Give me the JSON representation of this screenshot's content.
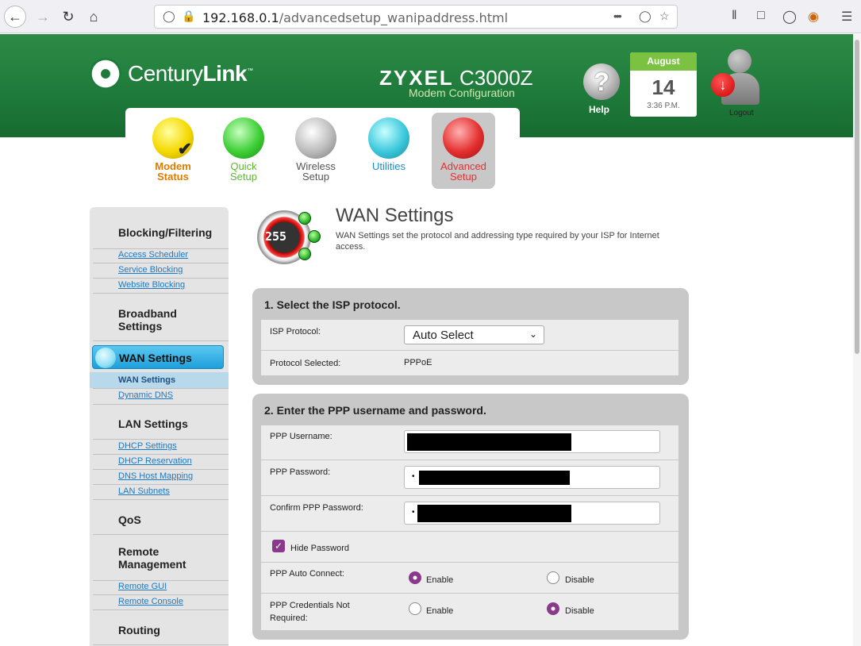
{
  "browser": {
    "url_host": "192.168.0.1",
    "url_path": "/advancedsetup_wanipaddress.html",
    "menu_dots": "•••"
  },
  "header": {
    "logo_prefix": "Century",
    "logo_bold": "Link",
    "logo_tm": "™",
    "brand": "ZYXEL",
    "model": "C3000Z",
    "subtitle": "Modem Configuration",
    "help_label": "Help",
    "date_month": "August",
    "date_day": "14",
    "date_time": "3:36 P.M.",
    "logout_label": "Logout"
  },
  "tabs": [
    {
      "line1": "Modem",
      "line2": "Status"
    },
    {
      "line1": "Quick",
      "line2": "Setup"
    },
    {
      "line1": "Wireless",
      "line2": "Setup"
    },
    {
      "line1": "Utilities",
      "line2": ""
    },
    {
      "line1": "Advanced",
      "line2": "Setup"
    }
  ],
  "sidebar": {
    "blocking_head": "Blocking/Filtering",
    "blocking_links": [
      "Access Scheduler",
      "Service Blocking",
      "Website Blocking"
    ],
    "broadband_head_1": "Broadband",
    "broadband_head_2": "Settings",
    "wan_active": "WAN Settings",
    "wan_sub_active": "WAN Settings",
    "wan_links": [
      "Dynamic DNS"
    ],
    "lan_head": "LAN Settings",
    "lan_links": [
      "DHCP Settings",
      "DHCP Reservation",
      "DNS Host Mapping",
      "LAN Subnets"
    ],
    "qos_head": "QoS",
    "remote_head_1": "Remote",
    "remote_head_2": "Management",
    "remote_links": [
      "Remote GUI",
      "Remote Console"
    ],
    "routing_head": "Routing"
  },
  "main": {
    "icon_number": "255",
    "title": "WAN Settings",
    "description": "WAN Settings set the protocol and addressing type required by your ISP for Internet access.",
    "section1": {
      "title": "1. Select the ISP protocol.",
      "protocol_label": "ISP Protocol:",
      "protocol_value": "Auto Select",
      "selected_label": "Protocol Selected:",
      "selected_value": "PPPoE"
    },
    "section2": {
      "title": "2. Enter the PPP username and password.",
      "username_label": "PPP Username:",
      "password_label": "PPP Password:",
      "confirm_label": "Confirm PPP Password:",
      "password_bullet": "•",
      "hide_password_label": "Hide Password",
      "hide_password_checked": true,
      "auto_connect_label": "PPP Auto Connect:",
      "auto_connect_value": "Enable",
      "credentials_label_1": "PPP Credentials Not",
      "credentials_label_2": "Required:",
      "credentials_value": "Disable",
      "enable_label": "Enable",
      "disable_label": "Disable"
    }
  },
  "colors": {
    "header_green": "#1e7a3a",
    "accent_purple": "#8b3a8b",
    "link_blue": "#1a7ac5",
    "active_blue": "#1e9fdb"
  }
}
